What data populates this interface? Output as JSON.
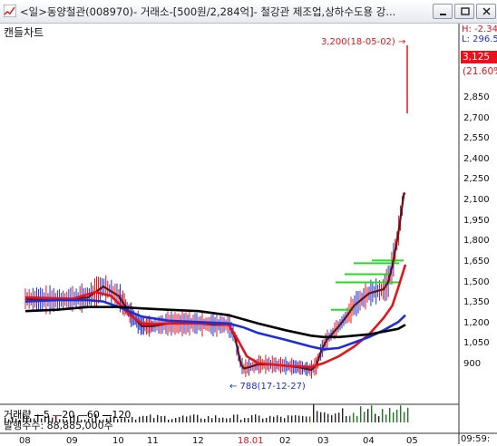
{
  "window": {
    "title": "<일>동양철관(008970)- 거래소-[500원/2,284억]- 철강관 제조업,상하수도용 강...",
    "buttons": [
      "minimize",
      "restore",
      "close"
    ]
  },
  "chart_label": "캔들차트",
  "header_right": {
    "high": "H: -2.34",
    "low": "L: 296.5",
    "current_price": "3,125",
    "change_pct": "(21.60%)",
    "colors": {
      "high": "#e8121b",
      "low": "#1b2fd6",
      "price_bg": "#e8121b"
    }
  },
  "annotations": {
    "peak": "3,200(18-05-02) →",
    "trough": "← 788(17-12-27)"
  },
  "volume_legend": {
    "label": "거래량",
    "items": [
      {
        "text": "5",
        "color": "#000000"
      },
      {
        "text": "20",
        "color": "#e8121b"
      },
      {
        "text": "60",
        "color": "#1b2fd6"
      },
      {
        "text": "120",
        "color": "#000000"
      }
    ]
  },
  "shares": "발행주수: 88,885,000주",
  "clock": "09:59:",
  "chart_data": {
    "type": "line",
    "title": "",
    "y_ticks": [
      "2,850",
      "2,700",
      "2,550",
      "2,400",
      "2,250",
      "2,100",
      "1,950",
      "1,800",
      "1,650",
      "1,500",
      "1,350",
      "1,200",
      "1,050",
      "900"
    ],
    "x_ticks": [
      "08",
      "09",
      "10",
      "11",
      "12",
      "18.01",
      "02",
      "03",
      "04",
      "05"
    ],
    "ylim": [
      800,
      3300
    ],
    "grid": false,
    "series": [
      {
        "name": "5",
        "color": "#6b1010",
        "points": [
          [
            0,
            1380
          ],
          [
            2,
            1370
          ],
          [
            4,
            1390
          ],
          [
            5,
            1470
          ],
          [
            6,
            1400
          ],
          [
            7,
            1270
          ],
          [
            8,
            1180
          ],
          [
            9,
            1180
          ],
          [
            10,
            1200
          ],
          [
            11,
            1200
          ],
          [
            12,
            1200
          ],
          [
            13,
            1190
          ],
          [
            14,
            1190
          ],
          [
            14.4,
            1100
          ],
          [
            14.8,
            900
          ],
          [
            15,
            870
          ],
          [
            15.4,
            880
          ],
          [
            16,
            900
          ],
          [
            17,
            900
          ],
          [
            18,
            890
          ],
          [
            19,
            880
          ],
          [
            20,
            860
          ],
          [
            20.4,
            890
          ],
          [
            20.8,
            1000
          ],
          [
            21.2,
            1080
          ],
          [
            22,
            1180
          ],
          [
            22.5,
            1250
          ],
          [
            23,
            1330
          ],
          [
            24,
            1420
          ],
          [
            25,
            1450
          ],
          [
            25.3,
            1500
          ],
          [
            25.6,
            1620
          ],
          [
            26,
            1850
          ],
          [
            26.4,
            2150
          ],
          [
            26.5,
            2150
          ]
        ]
      },
      {
        "name": "20",
        "color": "#e8121b",
        "points": [
          [
            0,
            1390
          ],
          [
            3,
            1380
          ],
          [
            4.5,
            1430
          ],
          [
            5.5,
            1400
          ],
          [
            7,
            1260
          ],
          [
            8,
            1200
          ],
          [
            9,
            1195
          ],
          [
            10,
            1200
          ],
          [
            12,
            1200
          ],
          [
            13,
            1200
          ],
          [
            14,
            1190
          ],
          [
            14.6,
            1080
          ],
          [
            15.2,
            960
          ],
          [
            16,
            910
          ],
          [
            18,
            890
          ],
          [
            20,
            880
          ],
          [
            21,
            910
          ],
          [
            22,
            960
          ],
          [
            23,
            1030
          ],
          [
            24,
            1120
          ],
          [
            25,
            1240
          ],
          [
            25.6,
            1330
          ],
          [
            26,
            1460
          ],
          [
            26.5,
            1630
          ]
        ]
      },
      {
        "name": "60",
        "color": "#1b2fd6",
        "points": [
          [
            0,
            1360
          ],
          [
            2,
            1370
          ],
          [
            4,
            1370
          ],
          [
            5,
            1360
          ],
          [
            6,
            1320
          ],
          [
            8,
            1250
          ],
          [
            10,
            1220
          ],
          [
            12,
            1210
          ],
          [
            14,
            1200
          ],
          [
            15,
            1170
          ],
          [
            16,
            1130
          ],
          [
            18,
            1080
          ],
          [
            20,
            1030
          ],
          [
            21,
            1010
          ],
          [
            22,
            1020
          ],
          [
            23,
            1060
          ],
          [
            24,
            1100
          ],
          [
            25,
            1150
          ],
          [
            26,
            1210
          ],
          [
            26.5,
            1260
          ]
        ]
      },
      {
        "name": "120",
        "color": "#000000",
        "points": [
          [
            0,
            1290
          ],
          [
            2,
            1300
          ],
          [
            4,
            1320
          ],
          [
            6,
            1320
          ],
          [
            8,
            1310
          ],
          [
            10,
            1300
          ],
          [
            12,
            1290
          ],
          [
            14,
            1260
          ],
          [
            16,
            1200
          ],
          [
            18,
            1150
          ],
          [
            20,
            1110
          ],
          [
            21,
            1100
          ],
          [
            22,
            1100
          ],
          [
            23,
            1110
          ],
          [
            24,
            1120
          ],
          [
            25,
            1140
          ],
          [
            26,
            1160
          ],
          [
            26.5,
            1190
          ]
        ]
      }
    ]
  }
}
